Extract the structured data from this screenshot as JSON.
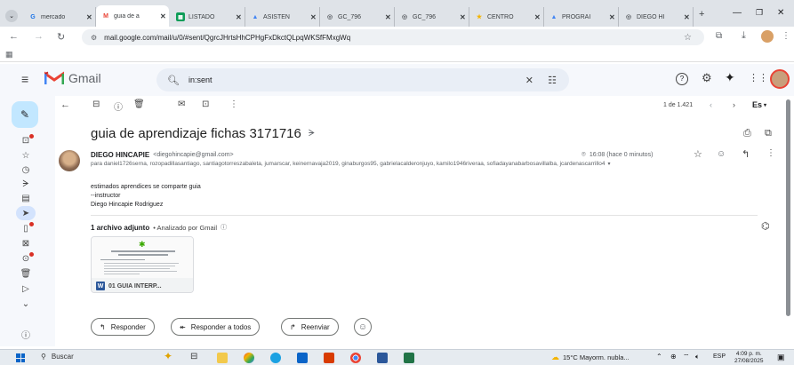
{
  "browser": {
    "tabs": [
      {
        "label": "mercado",
        "icon_color": "#1a73e8",
        "icon": "G"
      },
      {
        "label": "guia de a",
        "icon_color": "#ea4335",
        "icon": "M",
        "active": true
      },
      {
        "label": "LISTADO",
        "icon_color": "#0f9d58",
        "icon": "▦"
      },
      {
        "label": "ASISTEN",
        "icon_color": "#4285f4",
        "icon": "▲"
      },
      {
        "label": "GC_796",
        "icon_color": "#5f6368",
        "icon": "◎"
      },
      {
        "label": "GC_796",
        "icon_color": "#5f6368",
        "icon": "◎"
      },
      {
        "label": "CENTRO",
        "icon_color": "#f4b400",
        "icon": "★"
      },
      {
        "label": "PROGRAI",
        "icon_color": "#4285f4",
        "icon": "▲"
      },
      {
        "label": "DIEGO HI",
        "icon_color": "#5f6368",
        "icon": "◎"
      }
    ],
    "new_tab": "+",
    "url": "mail.google.com/mail/u/0/#sent/QgrcJHrtsHhCPHgFxDkctQLpqWKSfFMxgWq"
  },
  "gmail": {
    "brand": "Gmail",
    "search_value": "in:sent",
    "pager": "1 de 1.421",
    "lang": "Es"
  },
  "email": {
    "subject": "guia de aprendizaje fichas 3171716",
    "sender_name": "DIEGO HINCAPIE",
    "sender_email": "<diegohincapie@gmail.com>",
    "recipients": "para daniel1726serna, rozopadillasantiago, santiagotorreszabaleta, jumarscar, keinernavaja2019, ginaburgos95, gabrielacalderonjuyo, kamilo1946riveraa, sofiadayanabarbosavillalba, jcardenascarrillo4",
    "time": "16:08 (hace 0 minutos)",
    "body_lines": [
      "estimados aprendices se comparte guia",
      "--instructor",
      "Diego Hincapie Rodriguez"
    ],
    "attachments_title": "1 archivo adjunto",
    "attachments_scan": "• Analizado por Gmail",
    "attachment_name": "01 GUIA INTERP...",
    "actions": {
      "reply": "Responder",
      "reply_all": "Responder a todos",
      "forward": "Reenviar"
    }
  },
  "taskbar": {
    "search": "Buscar",
    "weather": "15°C  Mayorm. nubla...",
    "lang": "ESP",
    "time": "4:09 p. m.",
    "date": "27/08/2025"
  },
  "colors": {
    "accent": "#0b57d0",
    "compose": "#c2e7ff",
    "gmail_red": "#ea4335",
    "word_blue": "#2b579a"
  }
}
